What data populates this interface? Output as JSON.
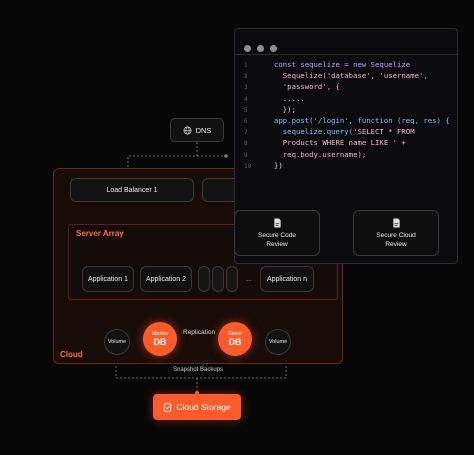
{
  "colors": {
    "accent": "#ff5a2a",
    "background": "#070707",
    "panel": "#0b0b0e"
  },
  "code_window": {
    "lines": [
      {
        "num": "1",
        "parts": [
          {
            "t": "const sequelize = new Sequelize",
            "c": "kw"
          }
        ]
      },
      {
        "num": "2",
        "parts": [
          {
            "t": "  Sequelize('database', 'username',",
            "c": "str"
          }
        ]
      },
      {
        "num": "3",
        "parts": [
          {
            "t": "  'password', {",
            "c": "str"
          }
        ]
      },
      {
        "num": "4",
        "parts": [
          {
            "t": "  .....",
            "c": "plain"
          }
        ]
      },
      {
        "num": "5",
        "parts": [
          {
            "t": "  });",
            "c": "plain"
          }
        ]
      },
      {
        "num": "6",
        "parts": [
          {
            "t": "app.post('/login', function (req, res) {",
            "c": "fn"
          }
        ]
      },
      {
        "num": "7",
        "parts": [
          {
            "t": "  sequelize.query(",
            "c": "fn"
          },
          {
            "t": "'SELECT * FROM",
            "c": "str"
          }
        ]
      },
      {
        "num": "8",
        "parts": [
          {
            "t": "  Products WHERE name LIKE ' +",
            "c": "str"
          }
        ]
      },
      {
        "num": "9",
        "parts": [
          {
            "t": "  req.body.username);",
            "c": "str"
          }
        ]
      },
      {
        "num": "10",
        "parts": [
          {
            "t": "})",
            "c": "plain"
          }
        ]
      }
    ],
    "review_boxes": [
      {
        "label": "Secure Code\nReview",
        "icon": "document-icon"
      },
      {
        "label": "Secure Cloud\nReview",
        "icon": "document-icon"
      }
    ]
  },
  "diagram": {
    "dns": "DNS",
    "load_balancer": "Load Balancer 1",
    "server_array": "Server Array",
    "cloud_label": "Cloud",
    "applications": [
      "Application 1",
      "Application 2",
      "...",
      "Application n"
    ],
    "volume": "Volume",
    "master_db": {
      "top": "Master",
      "bottom": "DB"
    },
    "slave_db": {
      "top": "Slave",
      "bottom": "DB"
    },
    "replication": "Replication",
    "snapshot": "Snapshot Backups",
    "storage": "Cloud Storage"
  }
}
